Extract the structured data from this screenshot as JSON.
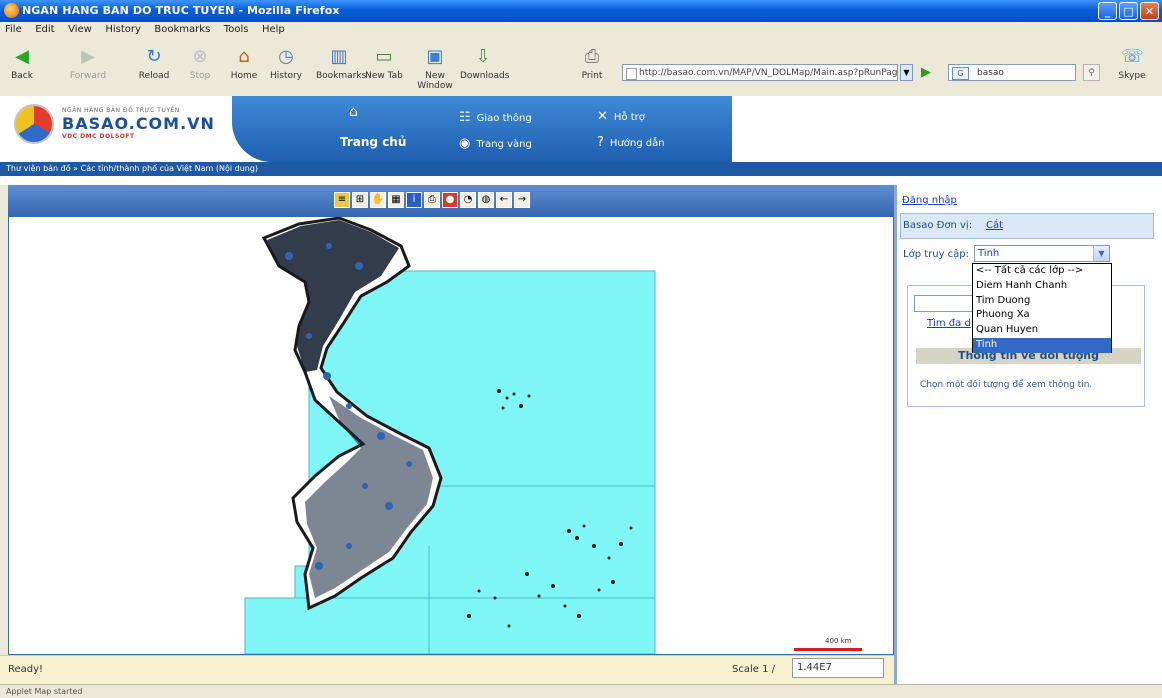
{
  "window": {
    "title": "NGAN HANG BAN DO TRUC TUYEN - Mozilla Firefox"
  },
  "menu": [
    "File",
    "Edit",
    "View",
    "History",
    "Bookmarks",
    "Tools",
    "Help"
  ],
  "toolbar": {
    "back": "Back",
    "forward": "Forward",
    "reload": "Reload",
    "stop": "Stop",
    "home": "Home",
    "history": "History",
    "bookmarks": "Bookmarks",
    "new_tab": "New Tab",
    "new_window": "New Window",
    "downloads": "Downloads",
    "print": "Print",
    "skype": "Skype",
    "url": "http://basao.com.vn/MAP/VN_DOLMap/Main.asp?pRunPage",
    "search_value": "basao"
  },
  "banner": {
    "logo_small": "NGÂN HÀNG BẢN ĐỒ TRỰC TUYẾN",
    "logo_main": "BASAO.COM.VN",
    "logo_sub": "VDC  DMC  DOLSOFT",
    "home_label": "Trang chủ",
    "nav": [
      {
        "label": "Giao thông",
        "icon": "traffic-icon"
      },
      {
        "label": "Trang vàng",
        "icon": "eye-icon"
      },
      {
        "label": "Hỗ trợ",
        "icon": "tools-icon"
      },
      {
        "label": "Hướng dẫn",
        "icon": "help-icon"
      }
    ]
  },
  "breadcrumb": "Thư viện bản đồ » Các tỉnh/thành phố của Việt Nam (Nội dung)",
  "map": {
    "scalebar_label": "400 km",
    "status": "Ready!",
    "scale_label": "Scale 1 /",
    "scale_value": "1.44E7"
  },
  "panel": {
    "login": "Đăng nhập",
    "unit_label": "Basao Đơn vị:",
    "unit_link": "Cắt",
    "layer_label": "Lớp truy cập:",
    "layer_selected": "Tinh",
    "find_link": "Tìm đa d",
    "info_heading": "Thông tin về đối tượng",
    "info_text": "Chọn một đối tượng để xem thông tin.",
    "layer_options": [
      "<-- Tất cả các lớp -->",
      "Diem Hanh Chanh",
      "Tim Duong",
      "Phuong Xa",
      "Quan Huyen",
      "Tinh"
    ]
  },
  "firefox_status": "Applet Map started",
  "colors": {
    "sea": "#7ff7f7",
    "land": "#ffffff",
    "banner_blue": "#2b6cbf",
    "selection": "#316ac5"
  }
}
